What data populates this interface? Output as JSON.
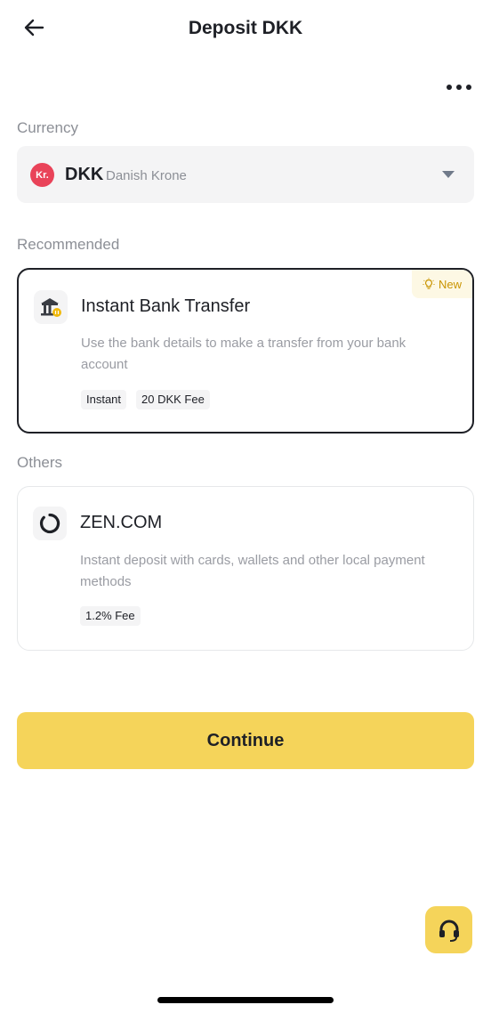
{
  "header": {
    "title": "Deposit DKK"
  },
  "currency": {
    "section_label": "Currency",
    "badge": "Kr.",
    "code": "DKK",
    "name": "Danish Krone",
    "badge_color": "#e94359"
  },
  "recommended": {
    "section_label": "Recommended",
    "method": {
      "icon": "bank-icon",
      "title": "Instant Bank Transfer",
      "description": "Use the bank details to make a transfer from your bank account",
      "badge": "New",
      "tags": [
        "Instant",
        "20 DKK Fee"
      ],
      "selected": true
    }
  },
  "others": {
    "section_label": "Others",
    "method": {
      "icon": "zen-logo-icon",
      "title": "ZEN.COM",
      "description": "Instant deposit with cards, wallets and other local payment methods",
      "tags": [
        "1.2% Fee"
      ]
    }
  },
  "actions": {
    "continue_label": "Continue"
  },
  "colors": {
    "accent": "#f5d45a",
    "text": "#1e2026",
    "muted": "#8c8f96"
  }
}
